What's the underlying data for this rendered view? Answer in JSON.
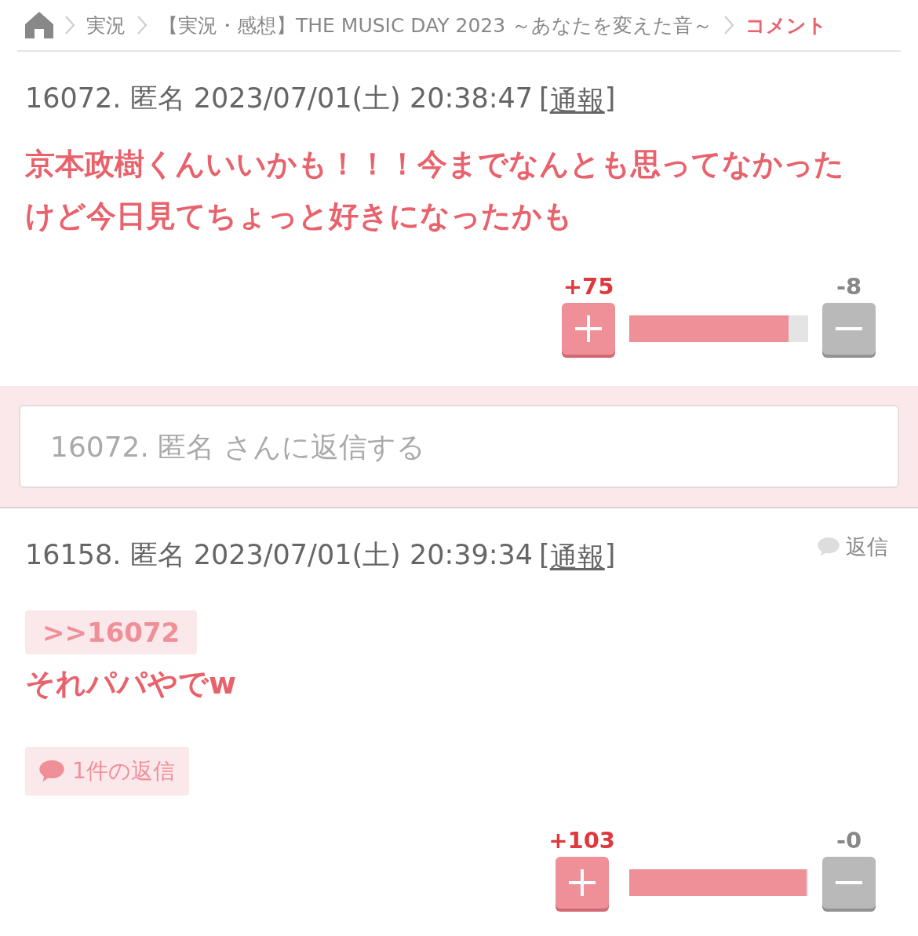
{
  "breadcrumb": [
    {
      "kind": "home",
      "selected": false
    },
    {
      "kind": "link",
      "label": "実況",
      "selected": false
    },
    {
      "kind": "link",
      "label": "【実況・感想】THE MUSIC DAY 2023 ～あなたを変えた音～",
      "selected": false
    },
    {
      "kind": "link",
      "label": "コメント",
      "selected": true
    }
  ],
  "items": [
    {
      "kind": "comment",
      "meta": "16072. 匿名 2023/07/01(土) 20:38:47",
      "bracket_open": "[",
      "report": "通報",
      "bracket_close": "]",
      "text": "京本政樹くんいいかも！！！今までなんとも思ってなかったけど今日見てちょっと好きになったかも",
      "plus_count": "+75",
      "minus_count": "-8",
      "level": 0.89
    },
    {
      "kind": "reply_form",
      "placeholder": "16072. 匿名 さんに返信する"
    },
    {
      "kind": "comment",
      "meta": "16158. 匿名 2023/07/01(土) 20:39:34",
      "bracket_open": "[",
      "report": "通報",
      "bracket_close": "]",
      "reply_button": "返信",
      "anchor": ">>16072",
      "text": "それパパやでw",
      "replies_button": "1件の返信",
      "plus_count": "+103",
      "minus_count": "-0",
      "level": 0.99
    }
  ]
}
